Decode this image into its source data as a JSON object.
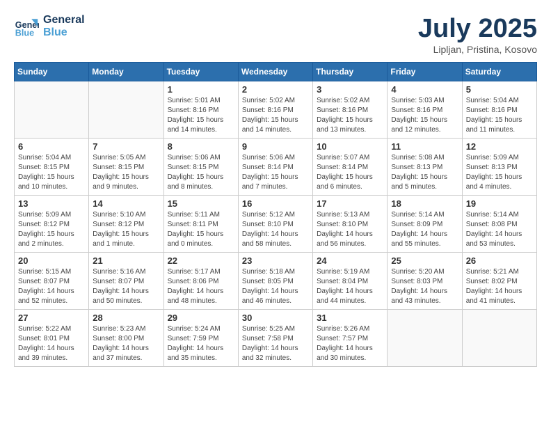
{
  "header": {
    "logo_line1": "General",
    "logo_line2": "Blue",
    "month": "July 2025",
    "location": "Lipljan, Pristina, Kosovo"
  },
  "weekdays": [
    "Sunday",
    "Monday",
    "Tuesday",
    "Wednesday",
    "Thursday",
    "Friday",
    "Saturday"
  ],
  "weeks": [
    [
      {
        "day": "",
        "info": ""
      },
      {
        "day": "",
        "info": ""
      },
      {
        "day": "1",
        "info": "Sunrise: 5:01 AM\nSunset: 8:16 PM\nDaylight: 15 hours\nand 14 minutes."
      },
      {
        "day": "2",
        "info": "Sunrise: 5:02 AM\nSunset: 8:16 PM\nDaylight: 15 hours\nand 14 minutes."
      },
      {
        "day": "3",
        "info": "Sunrise: 5:02 AM\nSunset: 8:16 PM\nDaylight: 15 hours\nand 13 minutes."
      },
      {
        "day": "4",
        "info": "Sunrise: 5:03 AM\nSunset: 8:16 PM\nDaylight: 15 hours\nand 12 minutes."
      },
      {
        "day": "5",
        "info": "Sunrise: 5:04 AM\nSunset: 8:16 PM\nDaylight: 15 hours\nand 11 minutes."
      }
    ],
    [
      {
        "day": "6",
        "info": "Sunrise: 5:04 AM\nSunset: 8:15 PM\nDaylight: 15 hours\nand 10 minutes."
      },
      {
        "day": "7",
        "info": "Sunrise: 5:05 AM\nSunset: 8:15 PM\nDaylight: 15 hours\nand 9 minutes."
      },
      {
        "day": "8",
        "info": "Sunrise: 5:06 AM\nSunset: 8:15 PM\nDaylight: 15 hours\nand 8 minutes."
      },
      {
        "day": "9",
        "info": "Sunrise: 5:06 AM\nSunset: 8:14 PM\nDaylight: 15 hours\nand 7 minutes."
      },
      {
        "day": "10",
        "info": "Sunrise: 5:07 AM\nSunset: 8:14 PM\nDaylight: 15 hours\nand 6 minutes."
      },
      {
        "day": "11",
        "info": "Sunrise: 5:08 AM\nSunset: 8:13 PM\nDaylight: 15 hours\nand 5 minutes."
      },
      {
        "day": "12",
        "info": "Sunrise: 5:09 AM\nSunset: 8:13 PM\nDaylight: 15 hours\nand 4 minutes."
      }
    ],
    [
      {
        "day": "13",
        "info": "Sunrise: 5:09 AM\nSunset: 8:12 PM\nDaylight: 15 hours\nand 2 minutes."
      },
      {
        "day": "14",
        "info": "Sunrise: 5:10 AM\nSunset: 8:12 PM\nDaylight: 15 hours\nand 1 minute."
      },
      {
        "day": "15",
        "info": "Sunrise: 5:11 AM\nSunset: 8:11 PM\nDaylight: 15 hours\nand 0 minutes."
      },
      {
        "day": "16",
        "info": "Sunrise: 5:12 AM\nSunset: 8:10 PM\nDaylight: 14 hours\nand 58 minutes."
      },
      {
        "day": "17",
        "info": "Sunrise: 5:13 AM\nSunset: 8:10 PM\nDaylight: 14 hours\nand 56 minutes."
      },
      {
        "day": "18",
        "info": "Sunrise: 5:14 AM\nSunset: 8:09 PM\nDaylight: 14 hours\nand 55 minutes."
      },
      {
        "day": "19",
        "info": "Sunrise: 5:14 AM\nSunset: 8:08 PM\nDaylight: 14 hours\nand 53 minutes."
      }
    ],
    [
      {
        "day": "20",
        "info": "Sunrise: 5:15 AM\nSunset: 8:07 PM\nDaylight: 14 hours\nand 52 minutes."
      },
      {
        "day": "21",
        "info": "Sunrise: 5:16 AM\nSunset: 8:07 PM\nDaylight: 14 hours\nand 50 minutes."
      },
      {
        "day": "22",
        "info": "Sunrise: 5:17 AM\nSunset: 8:06 PM\nDaylight: 14 hours\nand 48 minutes."
      },
      {
        "day": "23",
        "info": "Sunrise: 5:18 AM\nSunset: 8:05 PM\nDaylight: 14 hours\nand 46 minutes."
      },
      {
        "day": "24",
        "info": "Sunrise: 5:19 AM\nSunset: 8:04 PM\nDaylight: 14 hours\nand 44 minutes."
      },
      {
        "day": "25",
        "info": "Sunrise: 5:20 AM\nSunset: 8:03 PM\nDaylight: 14 hours\nand 43 minutes."
      },
      {
        "day": "26",
        "info": "Sunrise: 5:21 AM\nSunset: 8:02 PM\nDaylight: 14 hours\nand 41 minutes."
      }
    ],
    [
      {
        "day": "27",
        "info": "Sunrise: 5:22 AM\nSunset: 8:01 PM\nDaylight: 14 hours\nand 39 minutes."
      },
      {
        "day": "28",
        "info": "Sunrise: 5:23 AM\nSunset: 8:00 PM\nDaylight: 14 hours\nand 37 minutes."
      },
      {
        "day": "29",
        "info": "Sunrise: 5:24 AM\nSunset: 7:59 PM\nDaylight: 14 hours\nand 35 minutes."
      },
      {
        "day": "30",
        "info": "Sunrise: 5:25 AM\nSunset: 7:58 PM\nDaylight: 14 hours\nand 32 minutes."
      },
      {
        "day": "31",
        "info": "Sunrise: 5:26 AM\nSunset: 7:57 PM\nDaylight: 14 hours\nand 30 minutes."
      },
      {
        "day": "",
        "info": ""
      },
      {
        "day": "",
        "info": ""
      }
    ]
  ]
}
